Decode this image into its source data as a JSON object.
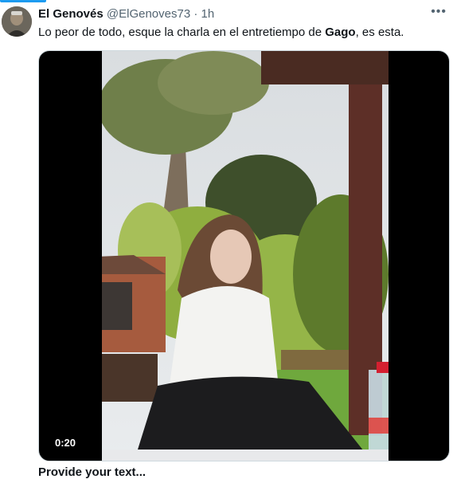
{
  "tweet": {
    "author_name": "El Genovés",
    "author_handle": "@ElGenoves73",
    "separator": "·",
    "time": "1h",
    "more_icon": "more-horizontal-icon",
    "text_before": "Lo peor de todo, esque la charla en el entretiempo de ",
    "text_bold": "Gago",
    "text_after": ", es esta.",
    "video_duration": "0:20",
    "next_text_partial": "Provide your text..."
  },
  "colors": {
    "accent": "#1d9bf0",
    "secondary_text": "#536471",
    "primary_text": "#0f1419"
  }
}
